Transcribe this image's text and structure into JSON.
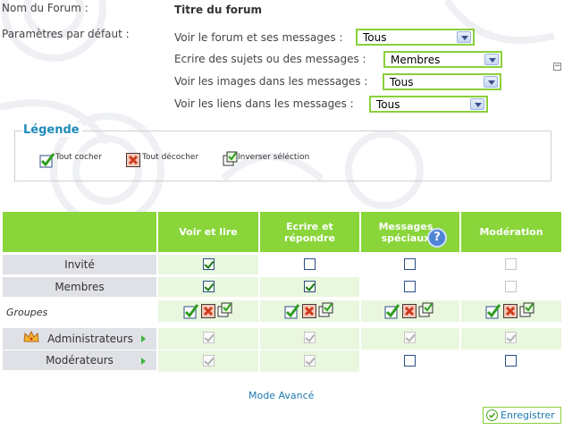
{
  "form": {
    "forum_name_label": "Nom du Forum :",
    "forum_name_value": "Titre du forum",
    "defaults_label": "Paramètres par défaut :",
    "permissions": [
      {
        "label": "Voir le forum et ses messages :",
        "value": "Tous"
      },
      {
        "label": "Ecrire des sujets ou des messages :",
        "value": "Membres"
      },
      {
        "label": "Voir les images dans les messages :",
        "value": "Tous"
      },
      {
        "label": "Voir les liens dans les messages :",
        "value": "Tous"
      }
    ],
    "collapse_symbol": "−"
  },
  "legend": {
    "title": "Légende",
    "items": [
      "Tout cocher",
      "Tout décocher",
      "Inverser séléction"
    ]
  },
  "table": {
    "columns": [
      "Voir et lire",
      "Ecrire et répondre",
      "Messages spéciaux",
      "Modération"
    ],
    "help_symbol": "?",
    "rows": [
      {
        "label": "Invité",
        "checks": [
          {
            "c": true,
            "d": false
          },
          {
            "c": false,
            "d": false
          },
          {
            "c": false,
            "d": false
          },
          {
            "c": false,
            "d": true
          }
        ]
      },
      {
        "label": "Membres",
        "checks": [
          {
            "c": true,
            "d": false
          },
          {
            "c": true,
            "d": false
          },
          {
            "c": false,
            "d": false
          },
          {
            "c": false,
            "d": true
          }
        ]
      }
    ],
    "groups_label": "Groupes",
    "group_rows": [
      {
        "label": "Administrateurs",
        "checks": [
          {
            "c": true,
            "d": true
          },
          {
            "c": true,
            "d": true
          },
          {
            "c": true,
            "d": true
          },
          {
            "c": true,
            "d": true
          }
        ]
      },
      {
        "label": "Modérateurs",
        "checks": [
          {
            "c": true,
            "d": true
          },
          {
            "c": true,
            "d": true
          },
          {
            "c": false,
            "d": false
          },
          {
            "c": false,
            "d": false
          }
        ]
      }
    ]
  },
  "footer": {
    "advanced_link": "Mode Avancé",
    "save_label": "Enregistrer"
  },
  "colors": {
    "accent_green": "#89d53a",
    "link_blue": "#1e7ab0",
    "legend_title": "#1e8ab8"
  }
}
